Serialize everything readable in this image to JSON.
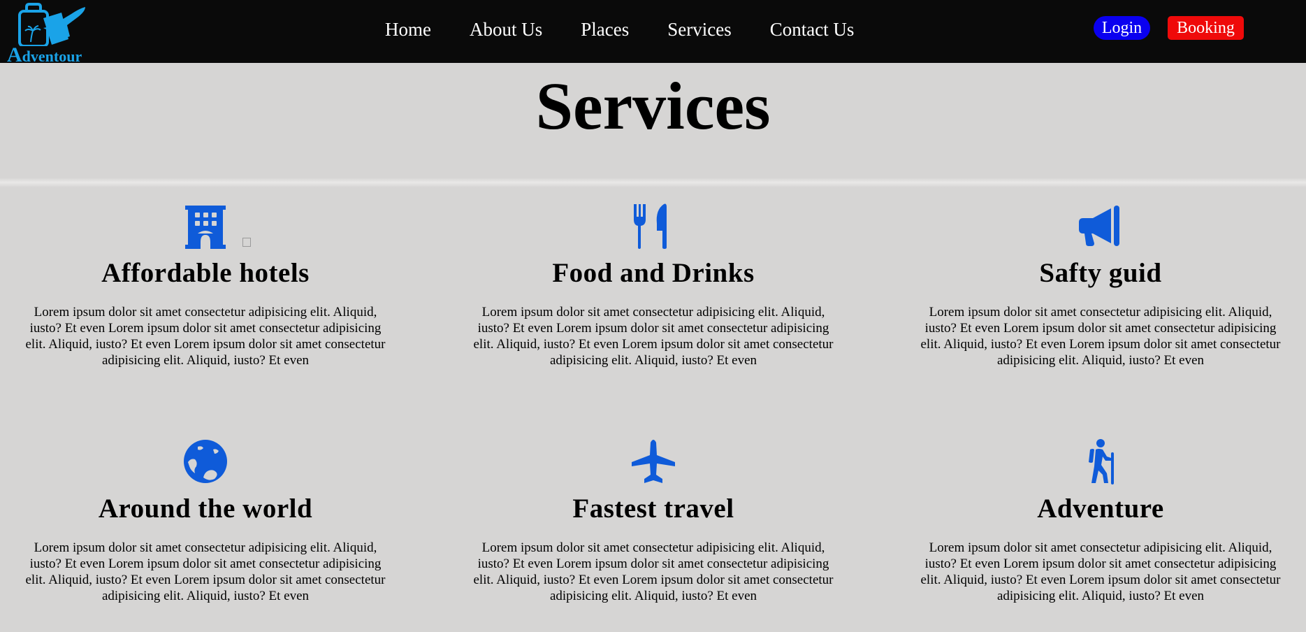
{
  "header": {
    "logo_text": "Adventour",
    "nav": [
      "Home",
      "About Us",
      "Places",
      "Services",
      "Contact Us"
    ],
    "login_label": "Login",
    "booking_label": "Booking"
  },
  "page_title": "Services",
  "colors": {
    "icon_blue": "#0f5bd9",
    "login_bg": "#0a00f0",
    "booking_bg": "#ef0a0a",
    "navbar_bg": "#0a0a0a",
    "page_bg": "#d6d5d4"
  },
  "services": [
    {
      "icon": "hotel-icon",
      "title": "Affordable hotels",
      "text": "Lorem ipsum dolor sit amet consectetur adipisicing elit. Aliquid, iusto? Et even Lorem ipsum dolor sit amet consectetur adipisicing elit. Aliquid, iusto? Et even Lorem ipsum dolor sit amet consectetur adipisicing elit. Aliquid, iusto? Et even"
    },
    {
      "icon": "utensils-icon",
      "title": "Food and Drinks",
      "text": "Lorem ipsum dolor sit amet consectetur adipisicing elit. Aliquid, iusto? Et even Lorem ipsum dolor sit amet consectetur adipisicing elit. Aliquid, iusto? Et even Lorem ipsum dolor sit amet consectetur adipisicing elit. Aliquid, iusto? Et even"
    },
    {
      "icon": "megaphone-icon",
      "title": "Safty guid",
      "text": "Lorem ipsum dolor sit amet consectetur adipisicing elit. Aliquid, iusto? Et even Lorem ipsum dolor sit amet consectetur adipisicing elit. Aliquid, iusto? Et even Lorem ipsum dolor sit amet consectetur adipisicing elit. Aliquid, iusto? Et even"
    },
    {
      "icon": "globe-icon",
      "title": "Around the world",
      "text": "Lorem ipsum dolor sit amet consectetur adipisicing elit. Aliquid, iusto? Et even Lorem ipsum dolor sit amet consectetur adipisicing elit. Aliquid, iusto? Et even Lorem ipsum dolor sit amet consectetur adipisicing elit. Aliquid, iusto? Et even"
    },
    {
      "icon": "plane-icon",
      "title": "Fastest travel",
      "text": "Lorem ipsum dolor sit amet consectetur adipisicing elit. Aliquid, iusto? Et even Lorem ipsum dolor sit amet consectetur adipisicing elit. Aliquid, iusto? Et even Lorem ipsum dolor sit amet consectetur adipisicing elit. Aliquid, iusto? Et even"
    },
    {
      "icon": "hiker-icon",
      "title": "Adventure",
      "text": "Lorem ipsum dolor sit amet consectetur adipisicing elit. Aliquid, iusto? Et even Lorem ipsum dolor sit amet consectetur adipisicing elit. Aliquid, iusto? Et even Lorem ipsum dolor sit amet consectetur adipisicing elit. Aliquid, iusto? Et even"
    }
  ]
}
